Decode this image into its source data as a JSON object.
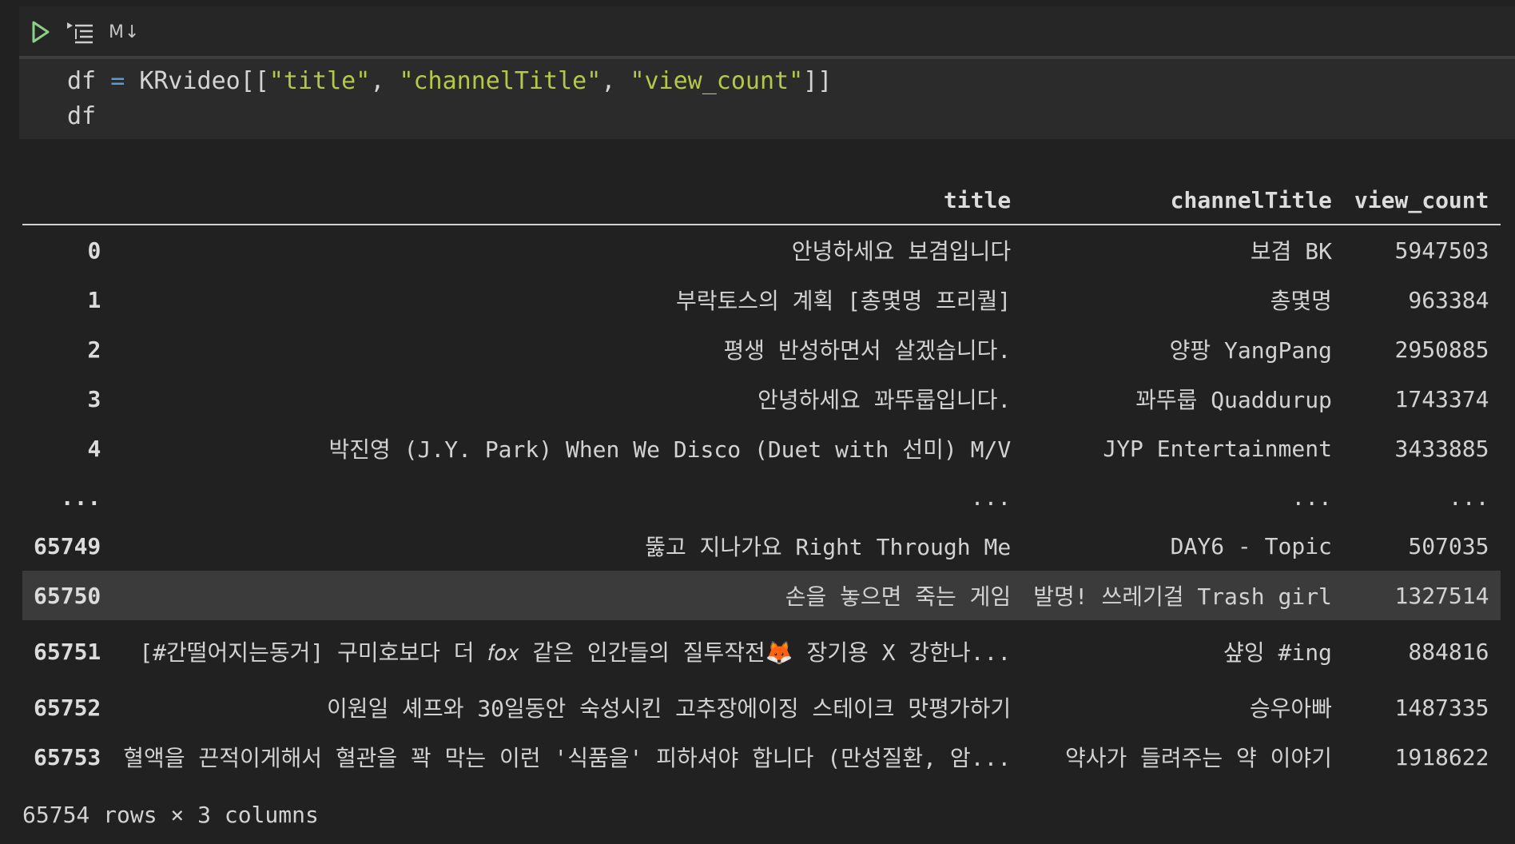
{
  "toolbar": {
    "run_icon": "play-icon",
    "run_by_line_icon": "run-by-line-icon",
    "markdown_label": "M↓"
  },
  "code": {
    "line1": {
      "var": "df",
      "op": "=",
      "obj": "KRvideo[[",
      "s1": "\"title\"",
      "s2": "\"channelTitle\"",
      "s3": "\"view_count\"",
      "end": "]]"
    },
    "line2": "df"
  },
  "table": {
    "columns": [
      "title",
      "channelTitle",
      "view_count"
    ],
    "rows": [
      {
        "index": "0",
        "title": "안녕하세요 보겸입니다",
        "channelTitle": "보겸 BK",
        "view_count": "5947503"
      },
      {
        "index": "1",
        "title": "부락토스의 계획 [총몇명 프리퀄]",
        "channelTitle": "총몇명",
        "view_count": "963384"
      },
      {
        "index": "2",
        "title": "평생 반성하면서 살겠습니다.",
        "channelTitle": "양팡 YangPang",
        "view_count": "2950885"
      },
      {
        "index": "3",
        "title": "안녕하세요 꽈뚜룹입니다.",
        "channelTitle": "꽈뚜룹 Quaddurup",
        "view_count": "1743374"
      },
      {
        "index": "4",
        "title": "박진영 (J.Y. Park) When We Disco (Duet with 선미) M/V",
        "channelTitle": "JYP Entertainment",
        "view_count": "3433885"
      },
      {
        "index": "...",
        "title": "...",
        "channelTitle": "...",
        "view_count": "..."
      },
      {
        "index": "65749",
        "title": "뚫고 지나가요 Right Through Me",
        "channelTitle": "DAY6 - Topic",
        "view_count": "507035"
      },
      {
        "index": "65750",
        "title": "손을 놓으면 죽는 게임",
        "channelTitle": "발명! 쓰레기걸 Trash girl",
        "view_count": "1327514"
      },
      {
        "index": "65751",
        "title": "[#간떨어지는동거] 구미호보다 더 𝑓𝑜𝑥 같은 인간들의 질투작전🦊 장기용 X 강한나...",
        "channelTitle": "샾잉 #ing",
        "view_count": "884816"
      },
      {
        "index": "65752",
        "title": "이원일 셰프와 30일동안 숙성시킨 고추장에이징 스테이크 맛평가하기",
        "channelTitle": "승우아빠",
        "view_count": "1487335"
      },
      {
        "index": "65753",
        "title": "혈액을 끈적이게해서 혈관을 꽉 막는 이런 '식품을' 피하셔야 합니다 (만성질환, 암...",
        "channelTitle": "약사가 들려주는 약 이야기",
        "view_count": "1918622"
      }
    ]
  },
  "summary": "65754 rows × 3 columns"
}
